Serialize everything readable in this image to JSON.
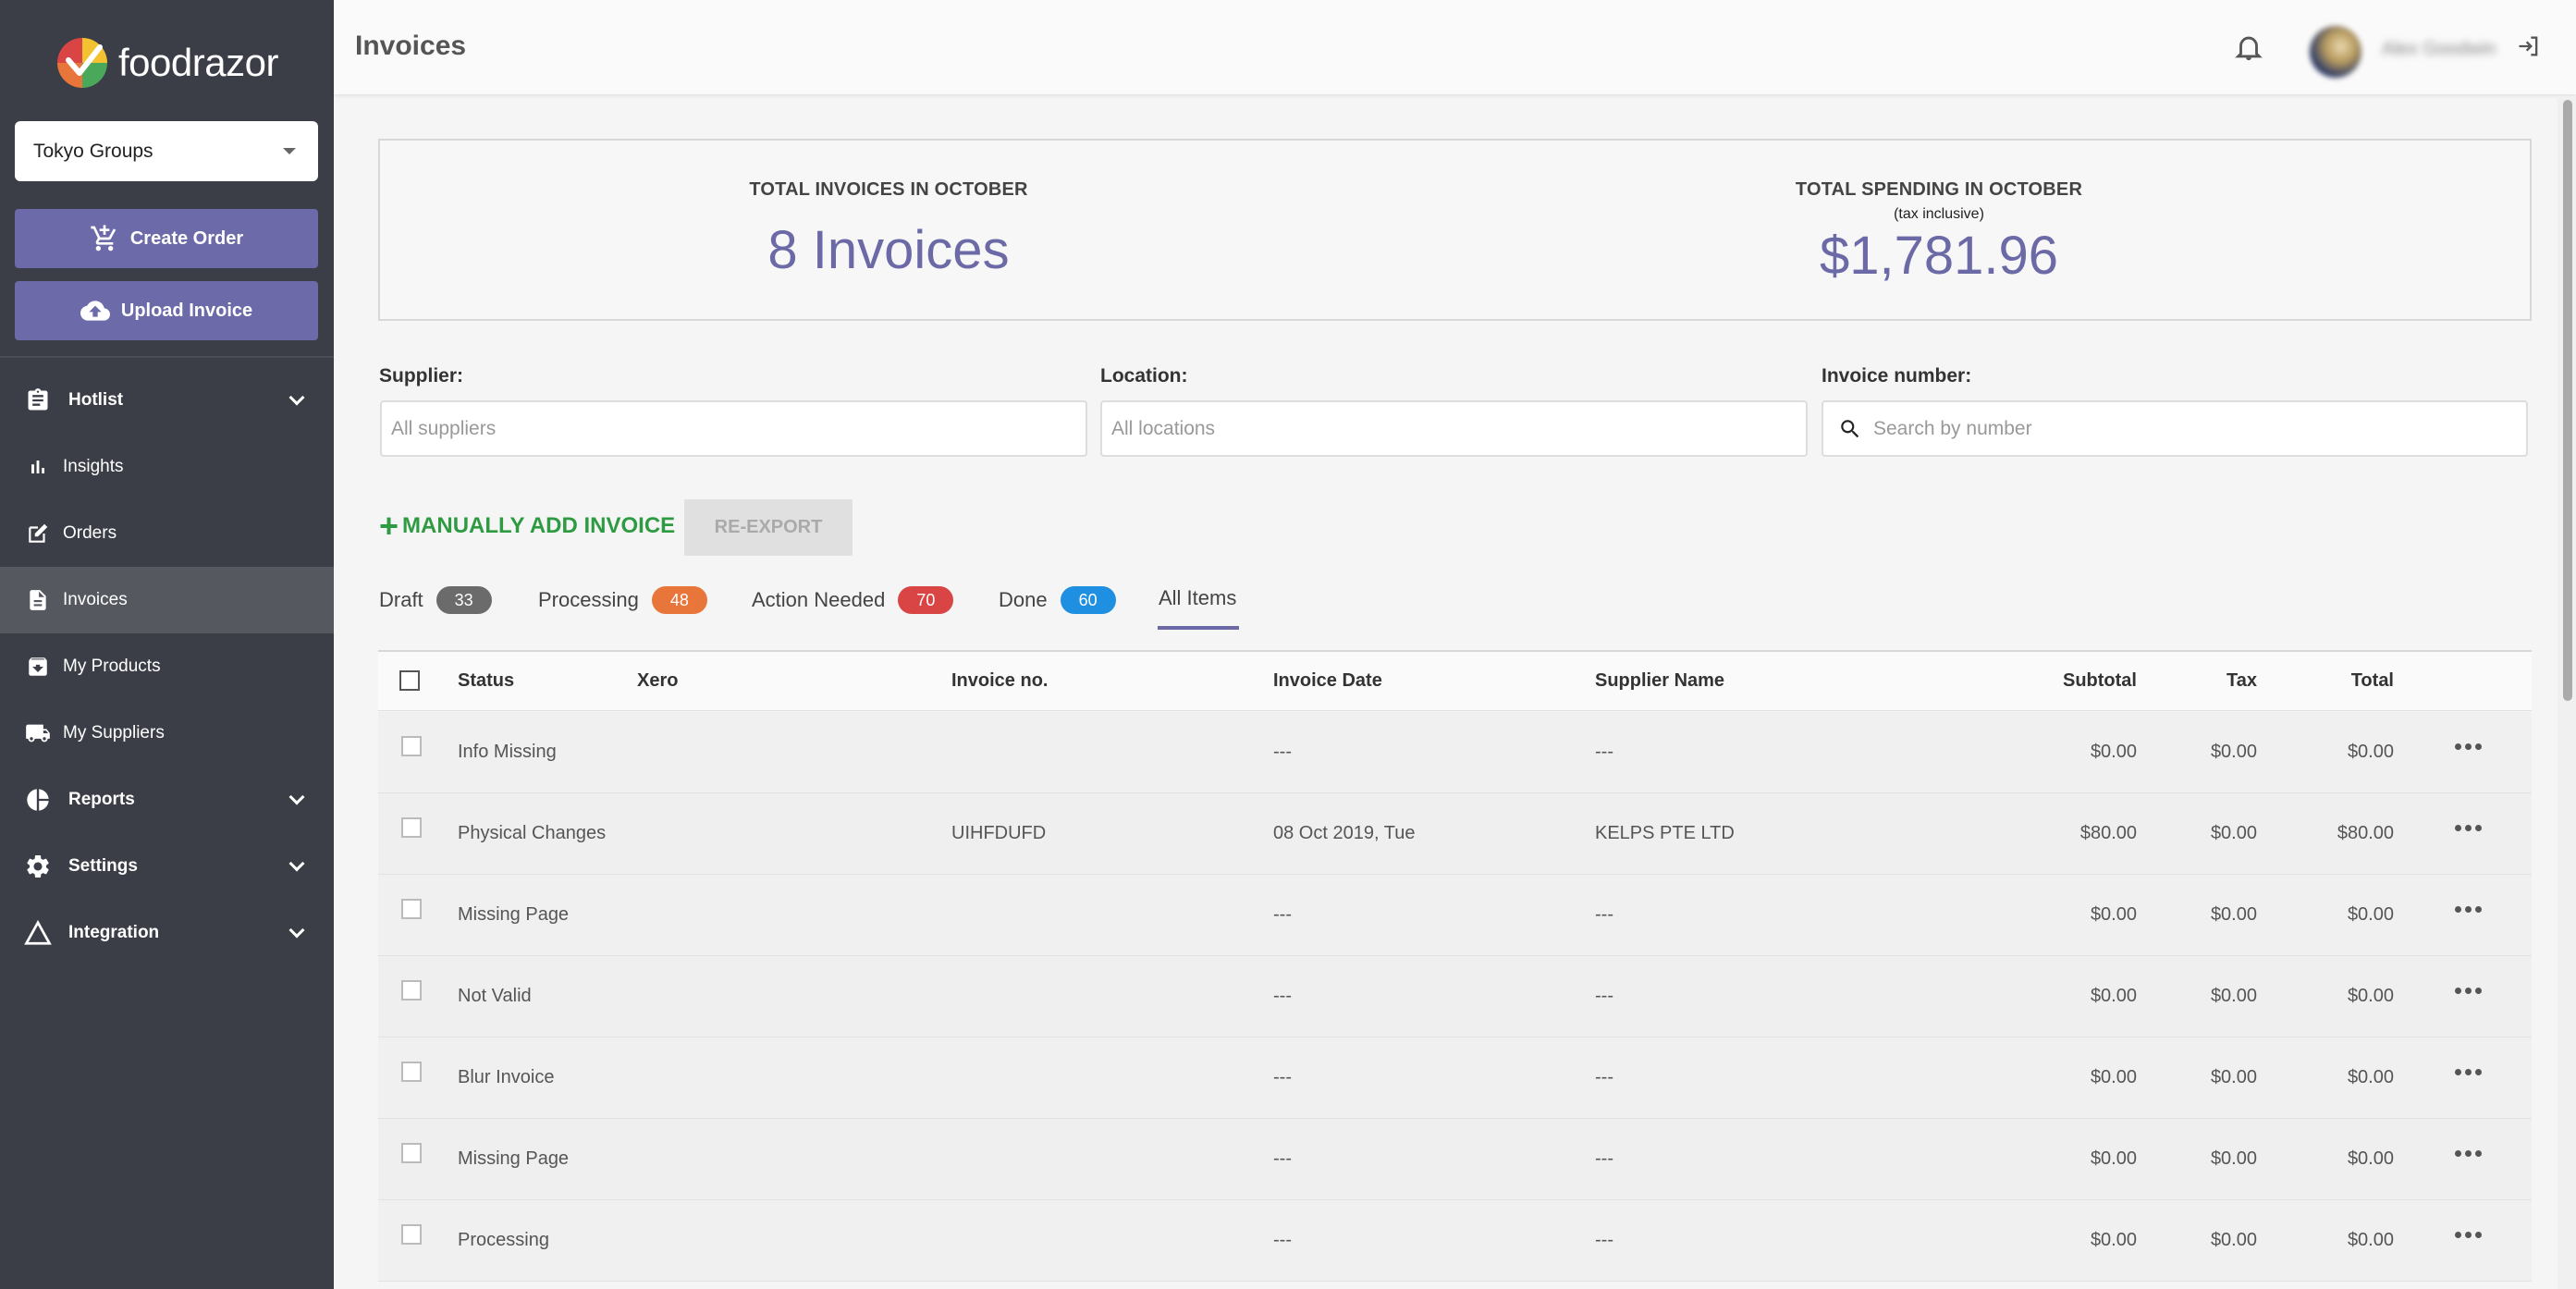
{
  "brand": {
    "name": "foodrazor"
  },
  "org_select": {
    "value": "Tokyo Groups"
  },
  "sidebar": {
    "create_order": "Create Order",
    "upload_invoice": "Upload Invoice",
    "items": [
      {
        "label": "Hotlist",
        "icon": "clipboard-icon",
        "expandable": true
      },
      {
        "label": "Insights",
        "icon": "bar-chart-icon",
        "expandable": false
      },
      {
        "label": "Orders",
        "icon": "edit-icon",
        "expandable": false
      },
      {
        "label": "Invoices",
        "icon": "invoice-icon",
        "expandable": false,
        "active": true
      },
      {
        "label": "My Products",
        "icon": "box-icon",
        "expandable": false
      },
      {
        "label": "My Suppliers",
        "icon": "truck-icon",
        "expandable": false
      },
      {
        "label": "Reports",
        "icon": "pie-chart-icon",
        "expandable": true
      },
      {
        "label": "Settings",
        "icon": "gear-icon",
        "expandable": true
      },
      {
        "label": "Integration",
        "icon": "triangle-icon",
        "expandable": true
      }
    ]
  },
  "header": {
    "title": "Invoices",
    "username": "Alex Goodwin"
  },
  "summary": {
    "invoices_label": "TOTAL INVOICES IN OCTOBER",
    "invoices_value": "8 Invoices",
    "spending_label": "TOTAL SPENDING IN OCTOBER",
    "spending_sub": "(tax inclusive)",
    "spending_value": "$1,781.96"
  },
  "filters": {
    "supplier_label": "Supplier:",
    "supplier_placeholder": "All suppliers",
    "location_label": "Location:",
    "location_placeholder": "All locations",
    "invoice_label": "Invoice number:",
    "invoice_placeholder": "Search by number"
  },
  "actions": {
    "add_invoice": "MANUALLY ADD INVOICE",
    "reexport": "RE-EXPORT"
  },
  "tabs": [
    {
      "label": "Draft",
      "count": "33",
      "color": "#6b6b6b"
    },
    {
      "label": "Processing",
      "count": "48",
      "color": "#e8753a"
    },
    {
      "label": "Action Needed",
      "count": "70",
      "color": "#d94545"
    },
    {
      "label": "Done",
      "count": "60",
      "color": "#1e8fe1"
    },
    {
      "label": "All Items",
      "active": true
    }
  ],
  "table": {
    "headers": {
      "status": "Status",
      "xero": "Xero",
      "invoice_no": "Invoice no.",
      "invoice_date": "Invoice Date",
      "supplier": "Supplier Name",
      "subtotal": "Subtotal",
      "tax": "Tax",
      "total": "Total"
    },
    "rows": [
      {
        "status": "Info Missing",
        "invoice_no": "",
        "date": "---",
        "supplier": "---",
        "subtotal": "$0.00",
        "tax": "$0.00",
        "total": "$0.00"
      },
      {
        "status": "Physical Changes",
        "invoice_no": "UIHFDUFD",
        "date": "08 Oct 2019, Tue",
        "supplier": "KELPS PTE LTD",
        "subtotal": "$80.00",
        "tax": "$0.00",
        "total": "$80.00"
      },
      {
        "status": "Missing Page",
        "invoice_no": "",
        "date": "---",
        "supplier": "---",
        "subtotal": "$0.00",
        "tax": "$0.00",
        "total": "$0.00"
      },
      {
        "status": "Not Valid",
        "invoice_no": "",
        "date": "---",
        "supplier": "---",
        "subtotal": "$0.00",
        "tax": "$0.00",
        "total": "$0.00"
      },
      {
        "status": "Blur Invoice",
        "invoice_no": "",
        "date": "---",
        "supplier": "---",
        "subtotal": "$0.00",
        "tax": "$0.00",
        "total": "$0.00"
      },
      {
        "status": "Missing Page",
        "invoice_no": "",
        "date": "---",
        "supplier": "---",
        "subtotal": "$0.00",
        "tax": "$0.00",
        "total": "$0.00"
      },
      {
        "status": "Processing",
        "invoice_no": "",
        "date": "---",
        "supplier": "---",
        "subtotal": "$0.00",
        "tax": "$0.00",
        "total": "$0.00"
      }
    ]
  }
}
